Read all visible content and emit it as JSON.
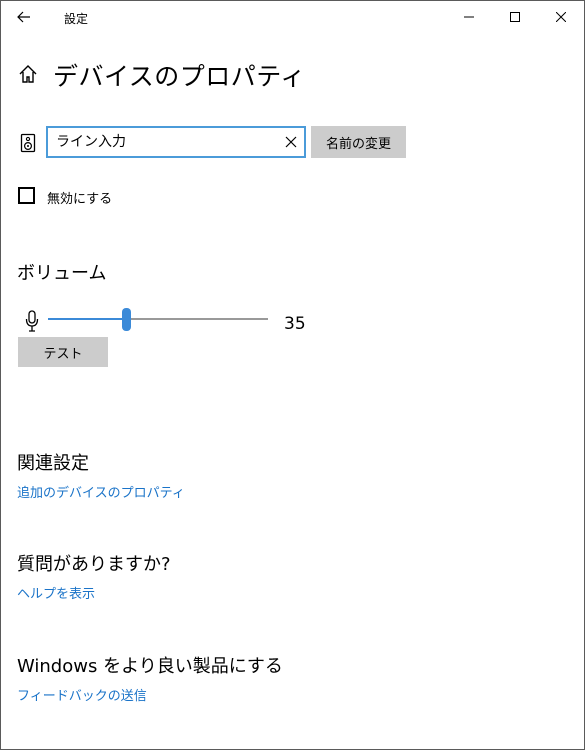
{
  "window": {
    "title": "設定",
    "icons": {
      "back": "back-arrow-icon",
      "minimize": "minimize-icon",
      "maximize": "maximize-icon",
      "close": "close-icon"
    }
  },
  "header": {
    "home_icon": "home-icon",
    "title": "デバイスのプロパティ"
  },
  "device": {
    "icon": "speaker-icon",
    "name_value": "ライン入力",
    "clear_icon": "clear-x-icon",
    "rename_label": "名前の変更"
  },
  "disable": {
    "label": "無効にする",
    "checked": false
  },
  "volume": {
    "heading": "ボリューム",
    "icon": "microphone-icon",
    "value": 35,
    "value_text": "35",
    "min": 0,
    "max": 100,
    "test_label": "テスト"
  },
  "related": {
    "heading": "関連設定",
    "link": "追加のデバイスのプロパティ"
  },
  "help": {
    "heading": "質問がありますか?",
    "link": "ヘルプを表示"
  },
  "feedback": {
    "heading": "Windows をより良い製品にする",
    "link": "フィードバックの送信"
  },
  "colors": {
    "accent": "#3b8ad8",
    "link": "#1a73c8",
    "button_bg": "#cccccc",
    "input_focus_border": "#4b9bd9"
  }
}
